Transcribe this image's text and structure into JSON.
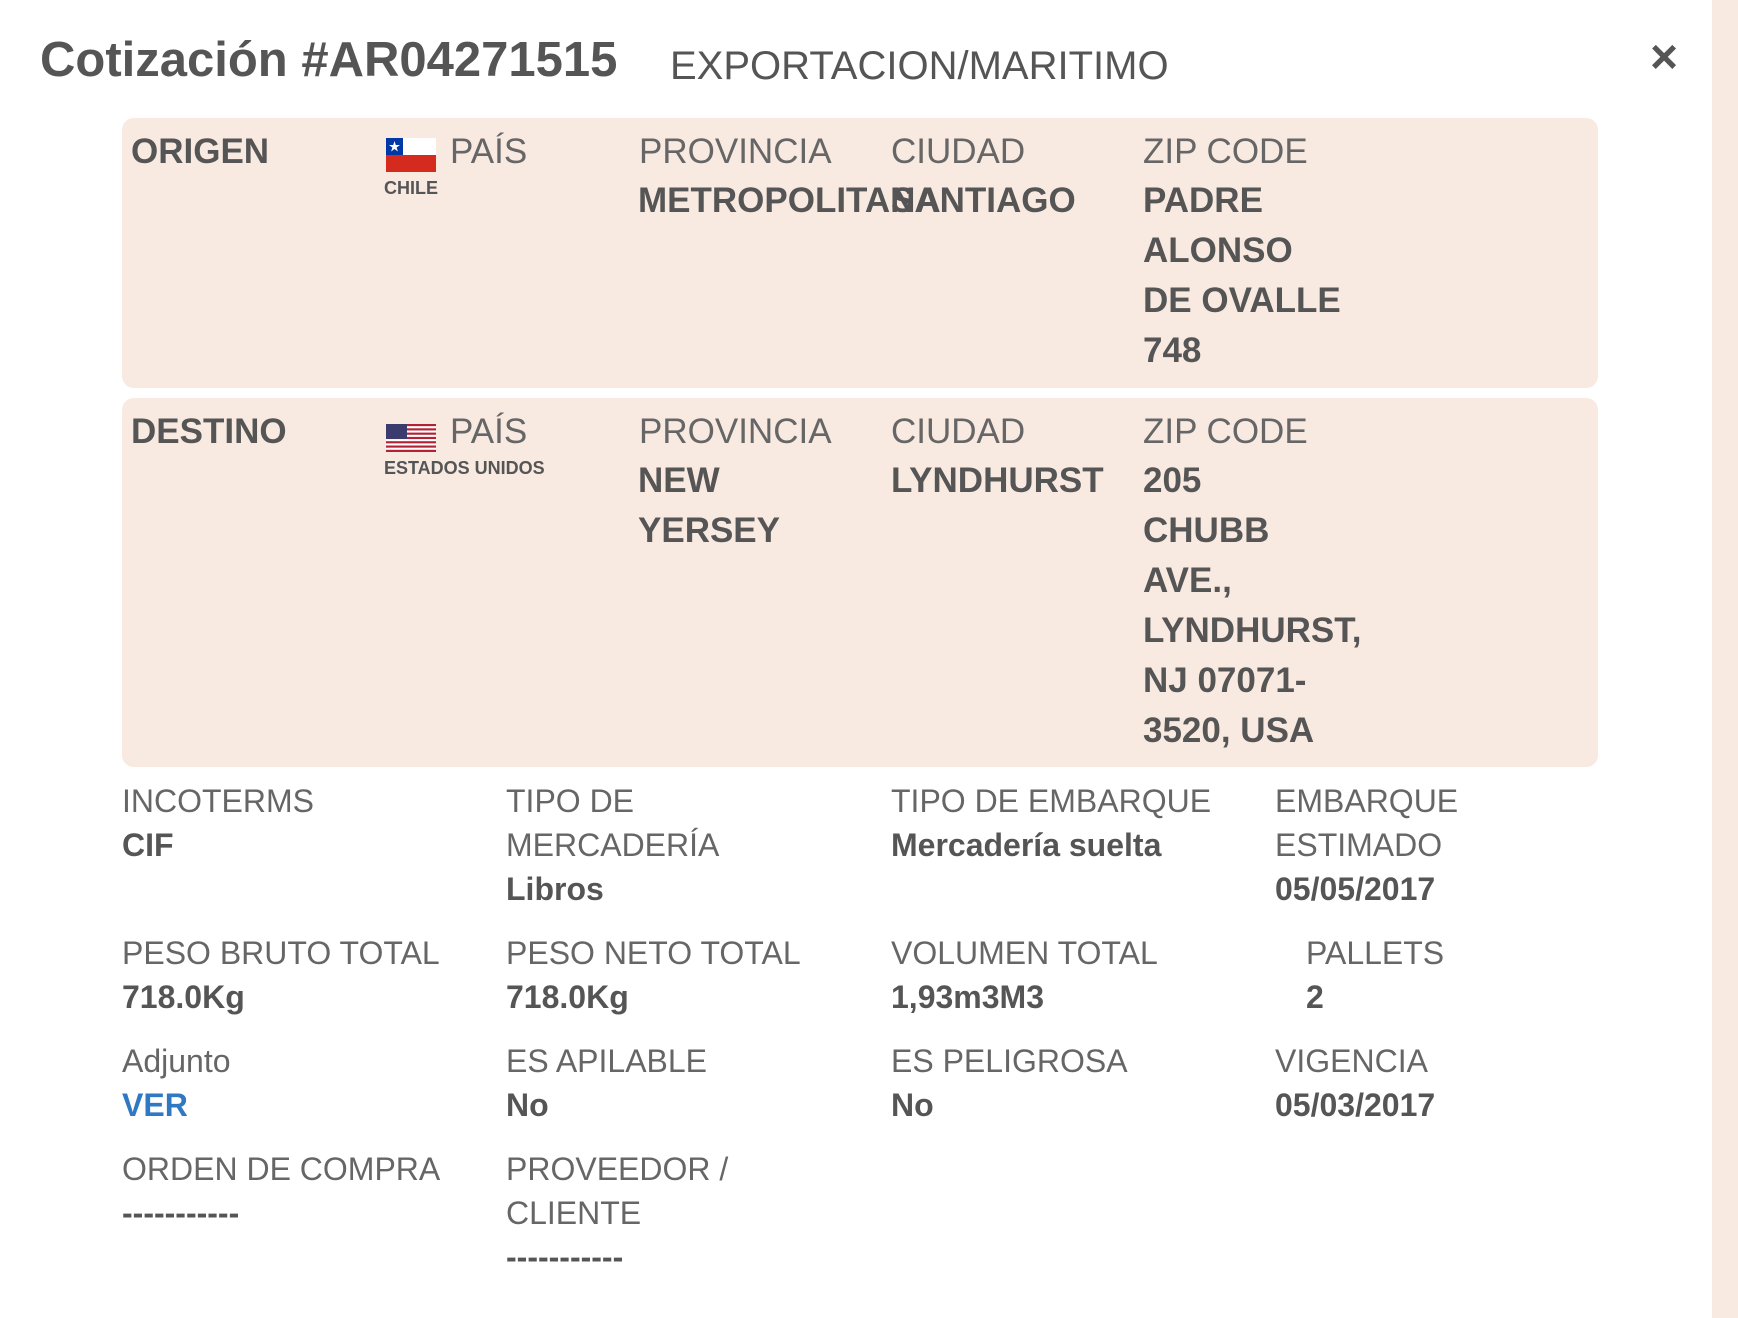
{
  "header": {
    "title": "Cotización #AR04271515",
    "subtitle": "EXPORTACION/MARITIMO",
    "close_label": "×"
  },
  "origin": {
    "label": "ORIGEN",
    "country_label": "PAÍS",
    "country": "CHILE",
    "province_label": "PROVINCIA",
    "province": "METROPOLITANA",
    "city_label": "CIUDAD",
    "city": "SANTIAGO",
    "zip_label": "ZIP CODE",
    "zip_lines": [
      "PADRE",
      "ALONSO",
      "DE OVALLE",
      "748"
    ]
  },
  "destination": {
    "label": "DESTINO",
    "country_label": "PAÍS",
    "country": "ESTADOS UNIDOS",
    "province_label": "PROVINCIA",
    "province_lines": [
      "NEW",
      "YERSEY"
    ],
    "city_label": "CIUDAD",
    "city": "LYNDHURST",
    "zip_label": "ZIP CODE",
    "zip_lines": [
      "205",
      "CHUBB",
      "AVE.,",
      "LYNDHURST,",
      "NJ 07071-",
      "3520, USA"
    ]
  },
  "details": {
    "incoterms_label": "INCOTERMS",
    "incoterms": "CIF",
    "tipo_mercaderia_label_1": "TIPO DE",
    "tipo_mercaderia_label_2": "MERCADERÍA",
    "tipo_mercaderia": "Libros",
    "tipo_embarque_label": "TIPO DE EMBARQUE",
    "tipo_embarque": "Mercadería suelta",
    "embarque_estimado_label_1": "EMBARQUE",
    "embarque_estimado_label_2": "ESTIMADO",
    "embarque_estimado": "05/05/2017",
    "peso_bruto_label": "PESO BRUTO TOTAL",
    "peso_bruto": "718.0Kg",
    "peso_neto_label": "PESO NETO TOTAL",
    "peso_neto": "718.0Kg",
    "volumen_label": "VOLUMEN TOTAL",
    "volumen": "1,93m3M3",
    "pallets_label": "PALLETS",
    "pallets": "2",
    "adjunto_label": "Adjunto",
    "adjunto_link": "VER",
    "apilable_label": "ES APILABLE",
    "apilable": "No",
    "peligrosa_label": "ES PELIGROSA",
    "peligrosa": "No",
    "vigencia_label": "VIGENCIA",
    "vigencia": "05/03/2017",
    "orden_compra_label": "ORDEN DE COMPRA",
    "orden_compra": "-----------",
    "proveedor_label_1": "PROVEEDOR /",
    "proveedor_label_2": "CLIENTE",
    "proveedor": "-----------"
  },
  "colors": {
    "panel_bg": "#f8e9e1",
    "text": "#555555",
    "link": "#2f78c4"
  },
  "icons": [
    "chile-flag-icon",
    "usa-flag-icon",
    "close-icon"
  ]
}
